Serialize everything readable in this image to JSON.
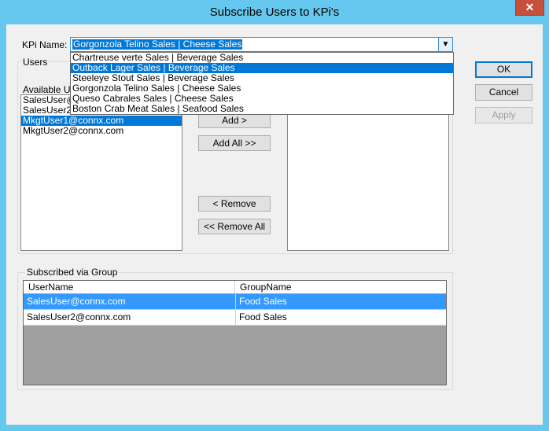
{
  "window": {
    "title": "Subscribe Users to KPi's",
    "close_glyph": "✕"
  },
  "kpi": {
    "label": "KPi Name:",
    "selected": "Gorgonzola Telino Sales | Cheese Sales",
    "dropdown_options": [
      "Chartreuse verte Sales | Beverage Sales",
      "Outback Lager Sales | Beverage Sales",
      "Steeleye Stout Sales | Beverage Sales",
      "Gorgonzola Telino Sales | Cheese Sales",
      "Queso Cabrales Sales | Cheese Sales",
      "Boston Crab Meat Sales | Seafood Sales"
    ],
    "highlighted_index": 1
  },
  "users": {
    "group_title": "Users",
    "available_label": "Available Us",
    "available_items": [
      "SalesUser@",
      "SalesUser2@",
      "MkgtUser1@connx.com",
      "MkgtUser2@connx.com"
    ],
    "selected_index": 2,
    "subscribed_items": []
  },
  "buttons": {
    "add": "Add >",
    "add_all": "Add All >>",
    "remove": "< Remove",
    "remove_all": "<< Remove All",
    "ok": "OK",
    "cancel": "Cancel",
    "apply": "Apply"
  },
  "group_subs": {
    "title": "Subscribed via Group",
    "columns": [
      "UserName",
      "GroupName"
    ],
    "rows": [
      {
        "user": "SalesUser@connx.com",
        "group": "Food Sales",
        "selected": true
      },
      {
        "user": "SalesUser2@connx.com",
        "group": "Food Sales",
        "selected": false
      }
    ]
  },
  "icons": {
    "combo_arrow": "chevron-down-icon"
  }
}
